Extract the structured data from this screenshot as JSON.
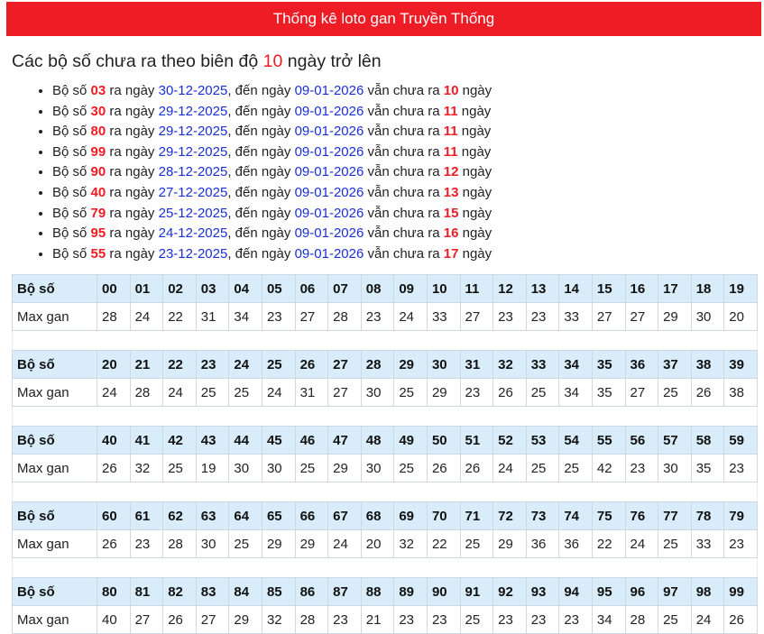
{
  "header": {
    "title": "Thống kê loto gan Truyền Thống"
  },
  "subtitle": {
    "prefix": "Các bộ số chưa ra theo biên độ",
    "days": "10",
    "suffix": "ngày trở lên"
  },
  "labels": {
    "bo_so_word": "Bộ số",
    "ra_ngay": "ra ngày",
    "den_ngay": ", đến ngày",
    "van_chua_ra": "vẫn chưa ra",
    "ngay": "ngày"
  },
  "stats": [
    {
      "num": "03",
      "from": "30-12-2025",
      "to": "09-01-2026",
      "days": "10"
    },
    {
      "num": "30",
      "from": "29-12-2025",
      "to": "09-01-2026",
      "days": "11"
    },
    {
      "num": "80",
      "from": "29-12-2025",
      "to": "09-01-2026",
      "days": "11"
    },
    {
      "num": "99",
      "from": "29-12-2025",
      "to": "09-01-2026",
      "days": "11"
    },
    {
      "num": "90",
      "from": "28-12-2025",
      "to": "09-01-2026",
      "days": "12"
    },
    {
      "num": "40",
      "from": "27-12-2025",
      "to": "09-01-2026",
      "days": "13"
    },
    {
      "num": "79",
      "from": "25-12-2025",
      "to": "09-01-2026",
      "days": "15"
    },
    {
      "num": "95",
      "from": "24-12-2025",
      "to": "09-01-2026",
      "days": "16"
    },
    {
      "num": "55",
      "from": "23-12-2025",
      "to": "09-01-2026",
      "days": "17"
    }
  ],
  "table": {
    "head_label": "Bộ số",
    "val_label": "Max gan",
    "groups": [
      {
        "numbers": [
          "00",
          "01",
          "02",
          "03",
          "04",
          "05",
          "06",
          "07",
          "08",
          "09",
          "10",
          "11",
          "12",
          "13",
          "14",
          "15",
          "16",
          "17",
          "18",
          "19"
        ],
        "values": [
          "28",
          "24",
          "22",
          "31",
          "34",
          "23",
          "27",
          "28",
          "23",
          "24",
          "33",
          "27",
          "23",
          "23",
          "33",
          "27",
          "27",
          "29",
          "30",
          "20"
        ]
      },
      {
        "numbers": [
          "20",
          "21",
          "22",
          "23",
          "24",
          "25",
          "26",
          "27",
          "28",
          "29",
          "30",
          "31",
          "32",
          "33",
          "34",
          "35",
          "36",
          "37",
          "38",
          "39"
        ],
        "values": [
          "24",
          "28",
          "24",
          "25",
          "25",
          "24",
          "31",
          "27",
          "30",
          "25",
          "29",
          "23",
          "26",
          "25",
          "34",
          "35",
          "27",
          "25",
          "26",
          "38"
        ]
      },
      {
        "numbers": [
          "40",
          "41",
          "42",
          "43",
          "44",
          "45",
          "46",
          "47",
          "48",
          "49",
          "50",
          "51",
          "52",
          "53",
          "54",
          "55",
          "56",
          "57",
          "58",
          "59"
        ],
        "values": [
          "26",
          "32",
          "25",
          "19",
          "30",
          "30",
          "25",
          "29",
          "30",
          "25",
          "26",
          "26",
          "24",
          "25",
          "25",
          "42",
          "23",
          "30",
          "35",
          "23"
        ]
      },
      {
        "numbers": [
          "60",
          "61",
          "62",
          "63",
          "64",
          "65",
          "66",
          "67",
          "68",
          "69",
          "70",
          "71",
          "72",
          "73",
          "74",
          "75",
          "76",
          "77",
          "78",
          "79"
        ],
        "values": [
          "26",
          "23",
          "28",
          "30",
          "25",
          "29",
          "29",
          "24",
          "20",
          "32",
          "22",
          "25",
          "29",
          "36",
          "36",
          "22",
          "24",
          "25",
          "33",
          "23"
        ]
      },
      {
        "numbers": [
          "80",
          "81",
          "82",
          "83",
          "84",
          "85",
          "86",
          "87",
          "88",
          "89",
          "90",
          "91",
          "92",
          "93",
          "94",
          "95",
          "96",
          "97",
          "98",
          "99"
        ],
        "values": [
          "40",
          "27",
          "26",
          "27",
          "29",
          "32",
          "28",
          "23",
          "21",
          "23",
          "23",
          "25",
          "23",
          "23",
          "23",
          "34",
          "28",
          "25",
          "24",
          "26"
        ]
      }
    ]
  }
}
